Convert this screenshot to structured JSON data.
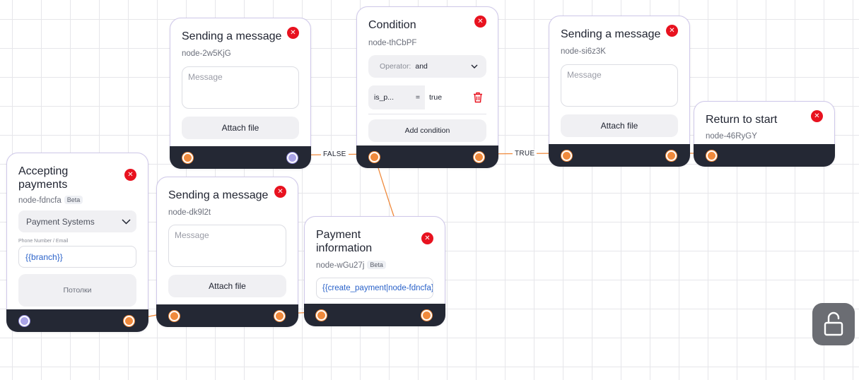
{
  "edge_labels": {
    "false": "FALSE",
    "true": "TRUE"
  },
  "nodes": {
    "message_1": {
      "title": "Sending a message",
      "id": "node-2w5KjG",
      "message_placeholder": "Message",
      "attach_label": "Attach file"
    },
    "condition": {
      "title": "Condition",
      "id": "node-thCbPF",
      "operator_label": "Operator:",
      "operator_value": "and",
      "rule_variable": "is_p...",
      "rule_comparator": "=",
      "rule_value": "true",
      "add_label": "Add condition"
    },
    "message_2": {
      "title": "Sending a message",
      "id": "node-si6z3K",
      "message_placeholder": "Message",
      "attach_label": "Attach file"
    },
    "return": {
      "title": "Return to start",
      "id": "node-46RyGY"
    },
    "accepting": {
      "title": "Accepting payments",
      "id": "node-fdncfa",
      "badge": "Beta",
      "select_value": "Payment Systems",
      "field_label": "Phone Number / Email",
      "field_value": "{{branch}}",
      "button_label": "Потолки"
    },
    "message_3": {
      "title": "Sending a message",
      "id": "node-dk9l2t",
      "message_placeholder": "Message",
      "attach_label": "Attach file"
    },
    "payment_info": {
      "title": "Payment information",
      "id": "node-wGu27j",
      "badge": "Beta",
      "field_value": "{{create_payment|node-fdncfa}}"
    }
  },
  "colors": {
    "accent_orange": "#f08a3c",
    "close_red": "#e8121f",
    "footer_dark": "#242834",
    "variable_blue": "#2a62c9",
    "lock_gray": "#6b6d73"
  },
  "icons": {
    "close": "close-icon",
    "chevron": "chevron-down-icon",
    "trash": "trash-icon",
    "lock": "unlock-icon"
  }
}
